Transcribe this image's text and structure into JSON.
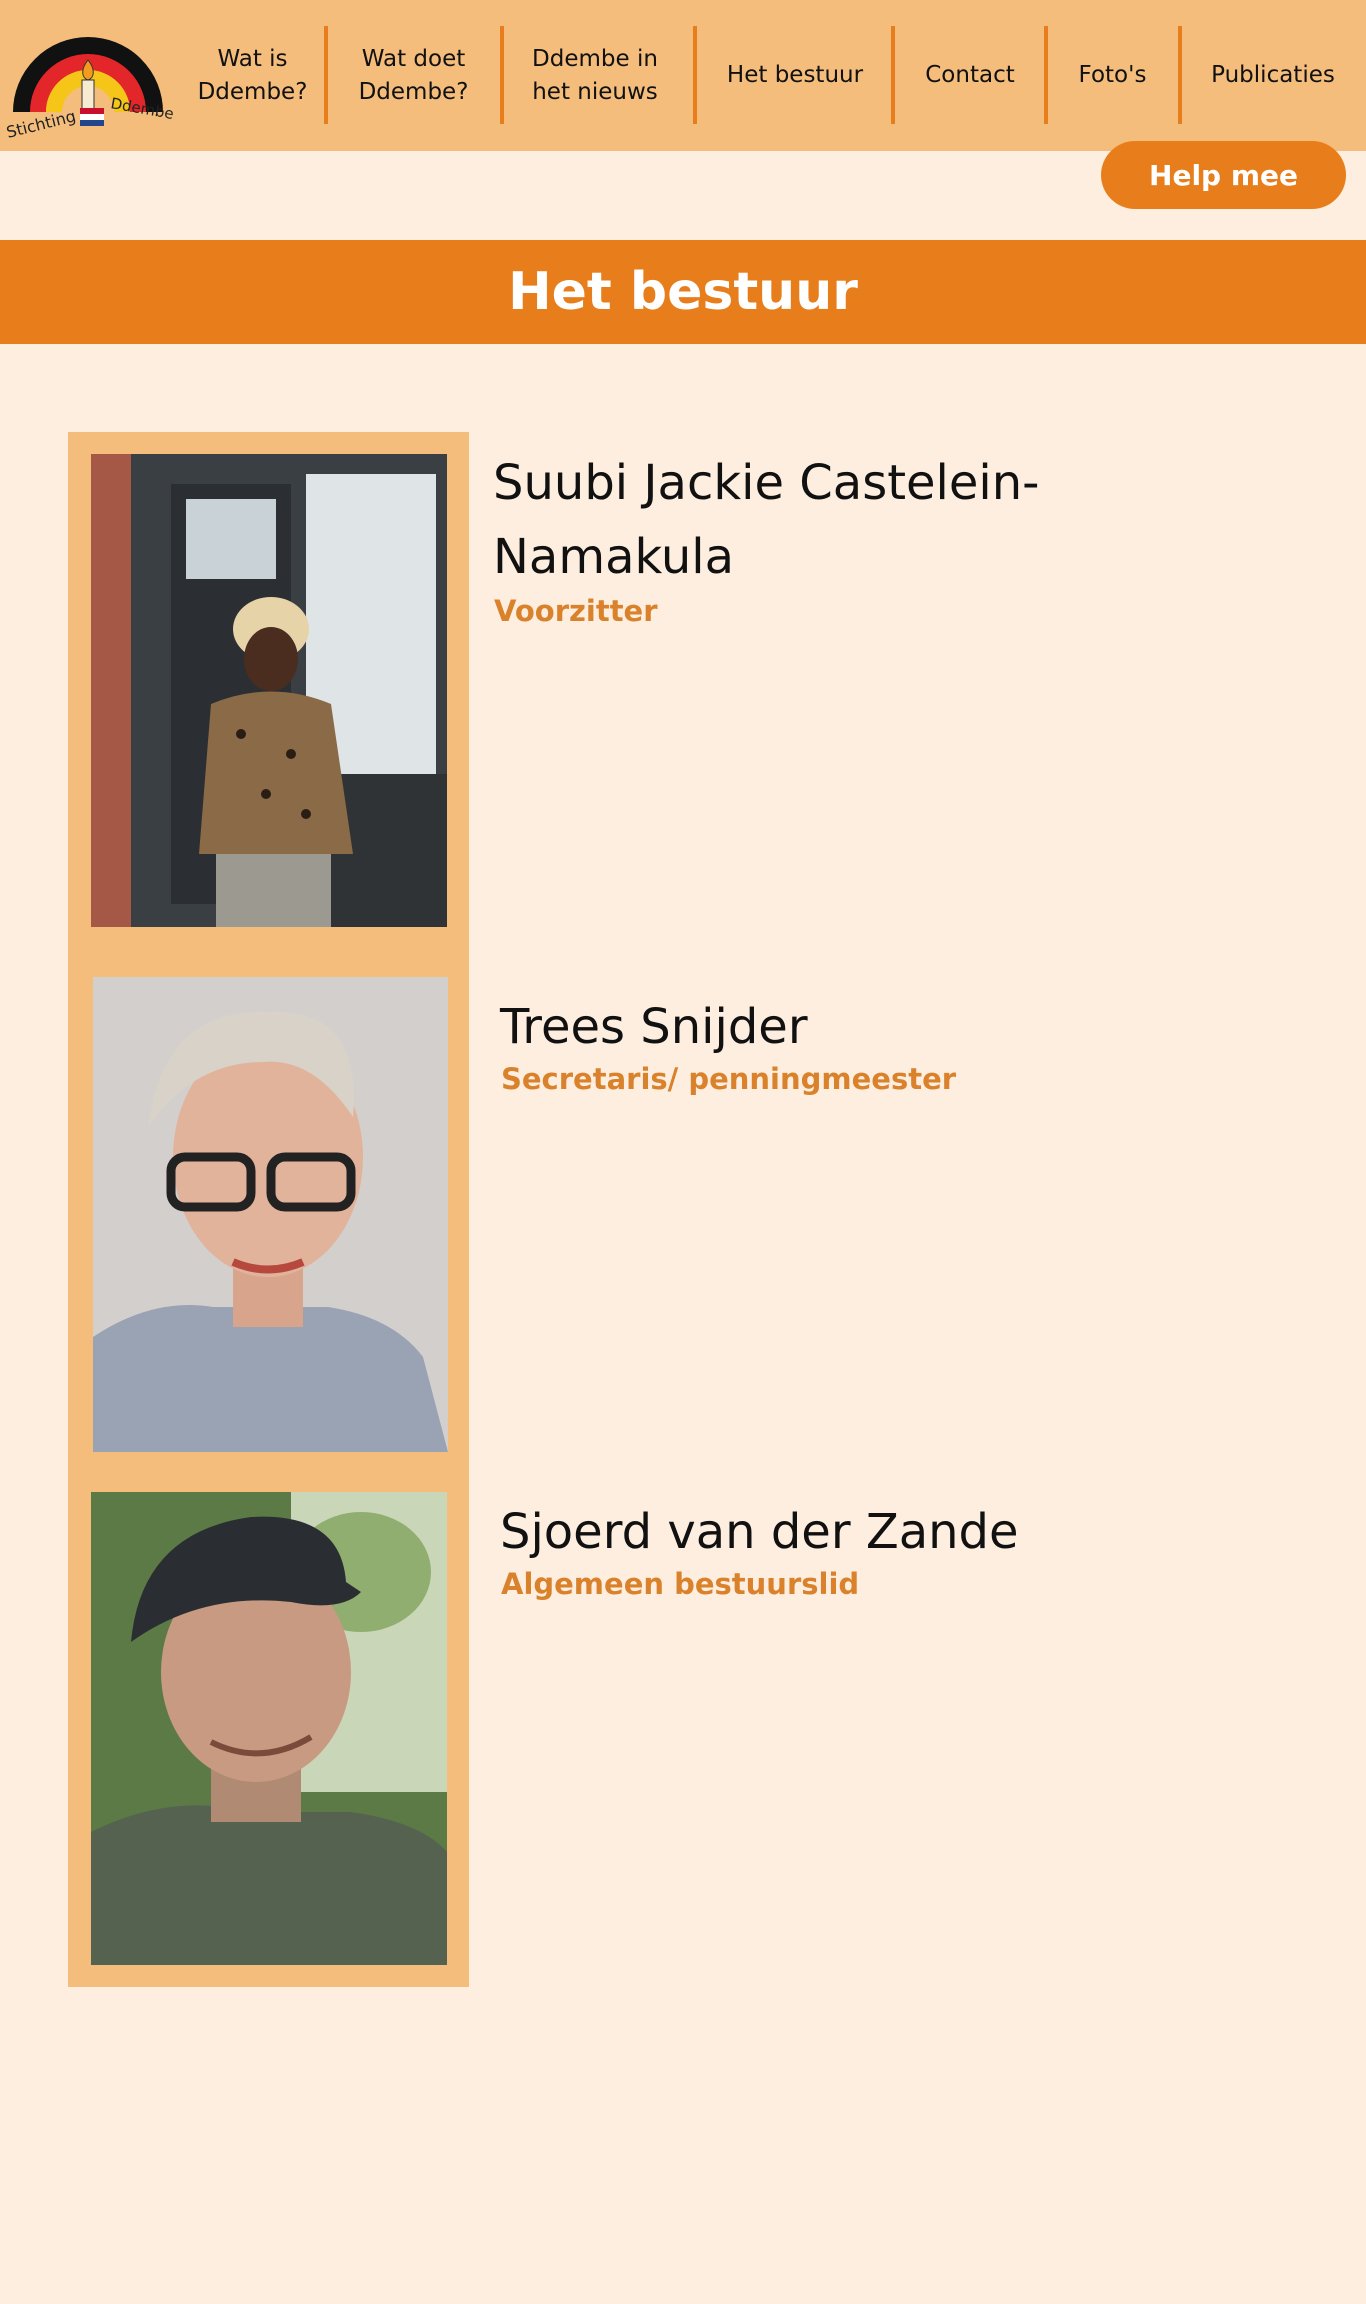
{
  "brand": {
    "logo_text_left": "Stichting",
    "logo_text_right": "Ddembe",
    "colors": {
      "header": "#f4bd7b",
      "accent": "#e87e1b",
      "background": "#fdeee0",
      "role_text": "#d9822b"
    }
  },
  "nav": {
    "items": [
      {
        "label": "Wat is Ddembe?"
      },
      {
        "label": "Wat doet Ddembe?"
      },
      {
        "label": "Ddembe in het nieuws"
      },
      {
        "label": "Het bestuur"
      },
      {
        "label": "Contact"
      },
      {
        "label": "Foto's"
      },
      {
        "label": "Publicaties"
      }
    ]
  },
  "help_button": {
    "label": "Help mee"
  },
  "page": {
    "title": "Het bestuur"
  },
  "members": [
    {
      "name": "Suubi Jackie Castelein-Namakula",
      "role": "Voorzitter"
    },
    {
      "name": "Trees Snijder",
      "role": "Secretaris/ penningmeester"
    },
    {
      "name": "Sjoerd van der Zande",
      "role": "Algemeen bestuurslid"
    }
  ]
}
